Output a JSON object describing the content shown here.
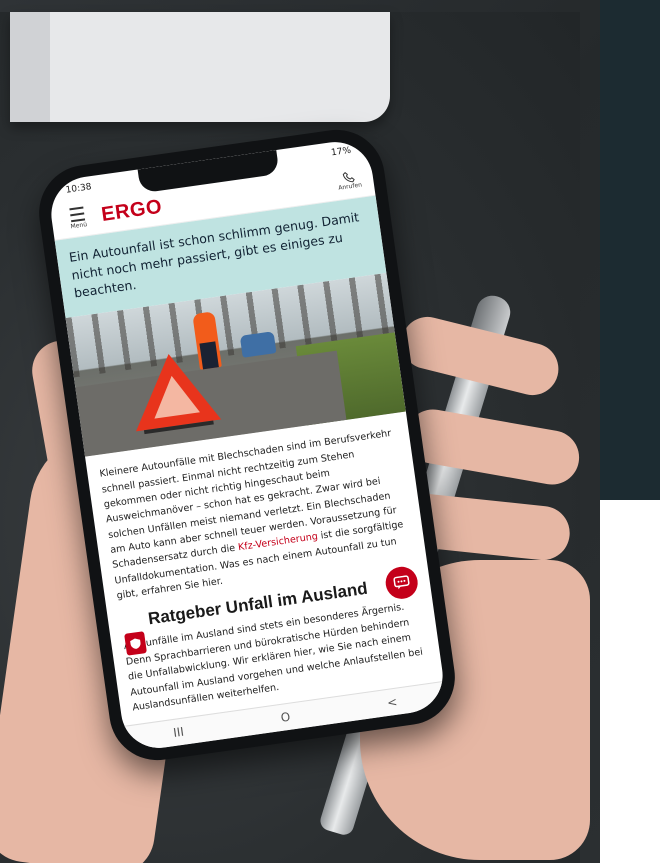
{
  "status_bar": {
    "time": "10:38",
    "signal": "17%"
  },
  "header": {
    "menu_label": "Menü",
    "logo": "ERGO",
    "call_label": "Anrufen"
  },
  "intro": {
    "text": "Ein Autounfall ist schon schlimm genug. Damit nicht noch mehr passiert, gibt es einiges zu beachten."
  },
  "article": {
    "paragraph_before_link": "Kleinere Autounfälle mit Blechschaden sind im Berufsverkehr schnell passiert. Einmal nicht rechtzeitig zum Stehen gekommen oder nicht richtig hingeschaut beim Ausweichmanöver – schon hat es gekracht. Zwar wird bei solchen Unfällen meist niemand verletzt. Ein Blechschaden am Auto kann aber schnell teuer werden. Voraussetzung für Schadensersatz durch die ",
    "link_text": "Kfz-Versicherung",
    "paragraph_after_link": " ist die sorgfältige Unfalldokumentation. Was es nach einem Autounfall zu tun gibt, erfahren Sie hier.",
    "section_heading": "Ratgeber Unfall im Ausland",
    "section_text": "Autounfälle im Ausland sind stets ein besonderes Ärgernis. Denn Sprachbarrieren und bürokratische Hürden behindern die Unfallabwicklung. Wir erklären hier, wie Sie nach einem Autounfall im Ausland vorgehen und welche Anlaufstellen bei Auslandsunfällen weiterhelfen."
  },
  "system_nav": {
    "recents": "III",
    "home": "O",
    "back": "<"
  },
  "colors": {
    "brand_red": "#c4001a",
    "intro_bg": "#bfe3e1",
    "panel_dark": "#1c2b31"
  },
  "icons": [
    "hamburger-menu-icon",
    "phone-call-icon",
    "chat-icon",
    "shield-icon"
  ]
}
